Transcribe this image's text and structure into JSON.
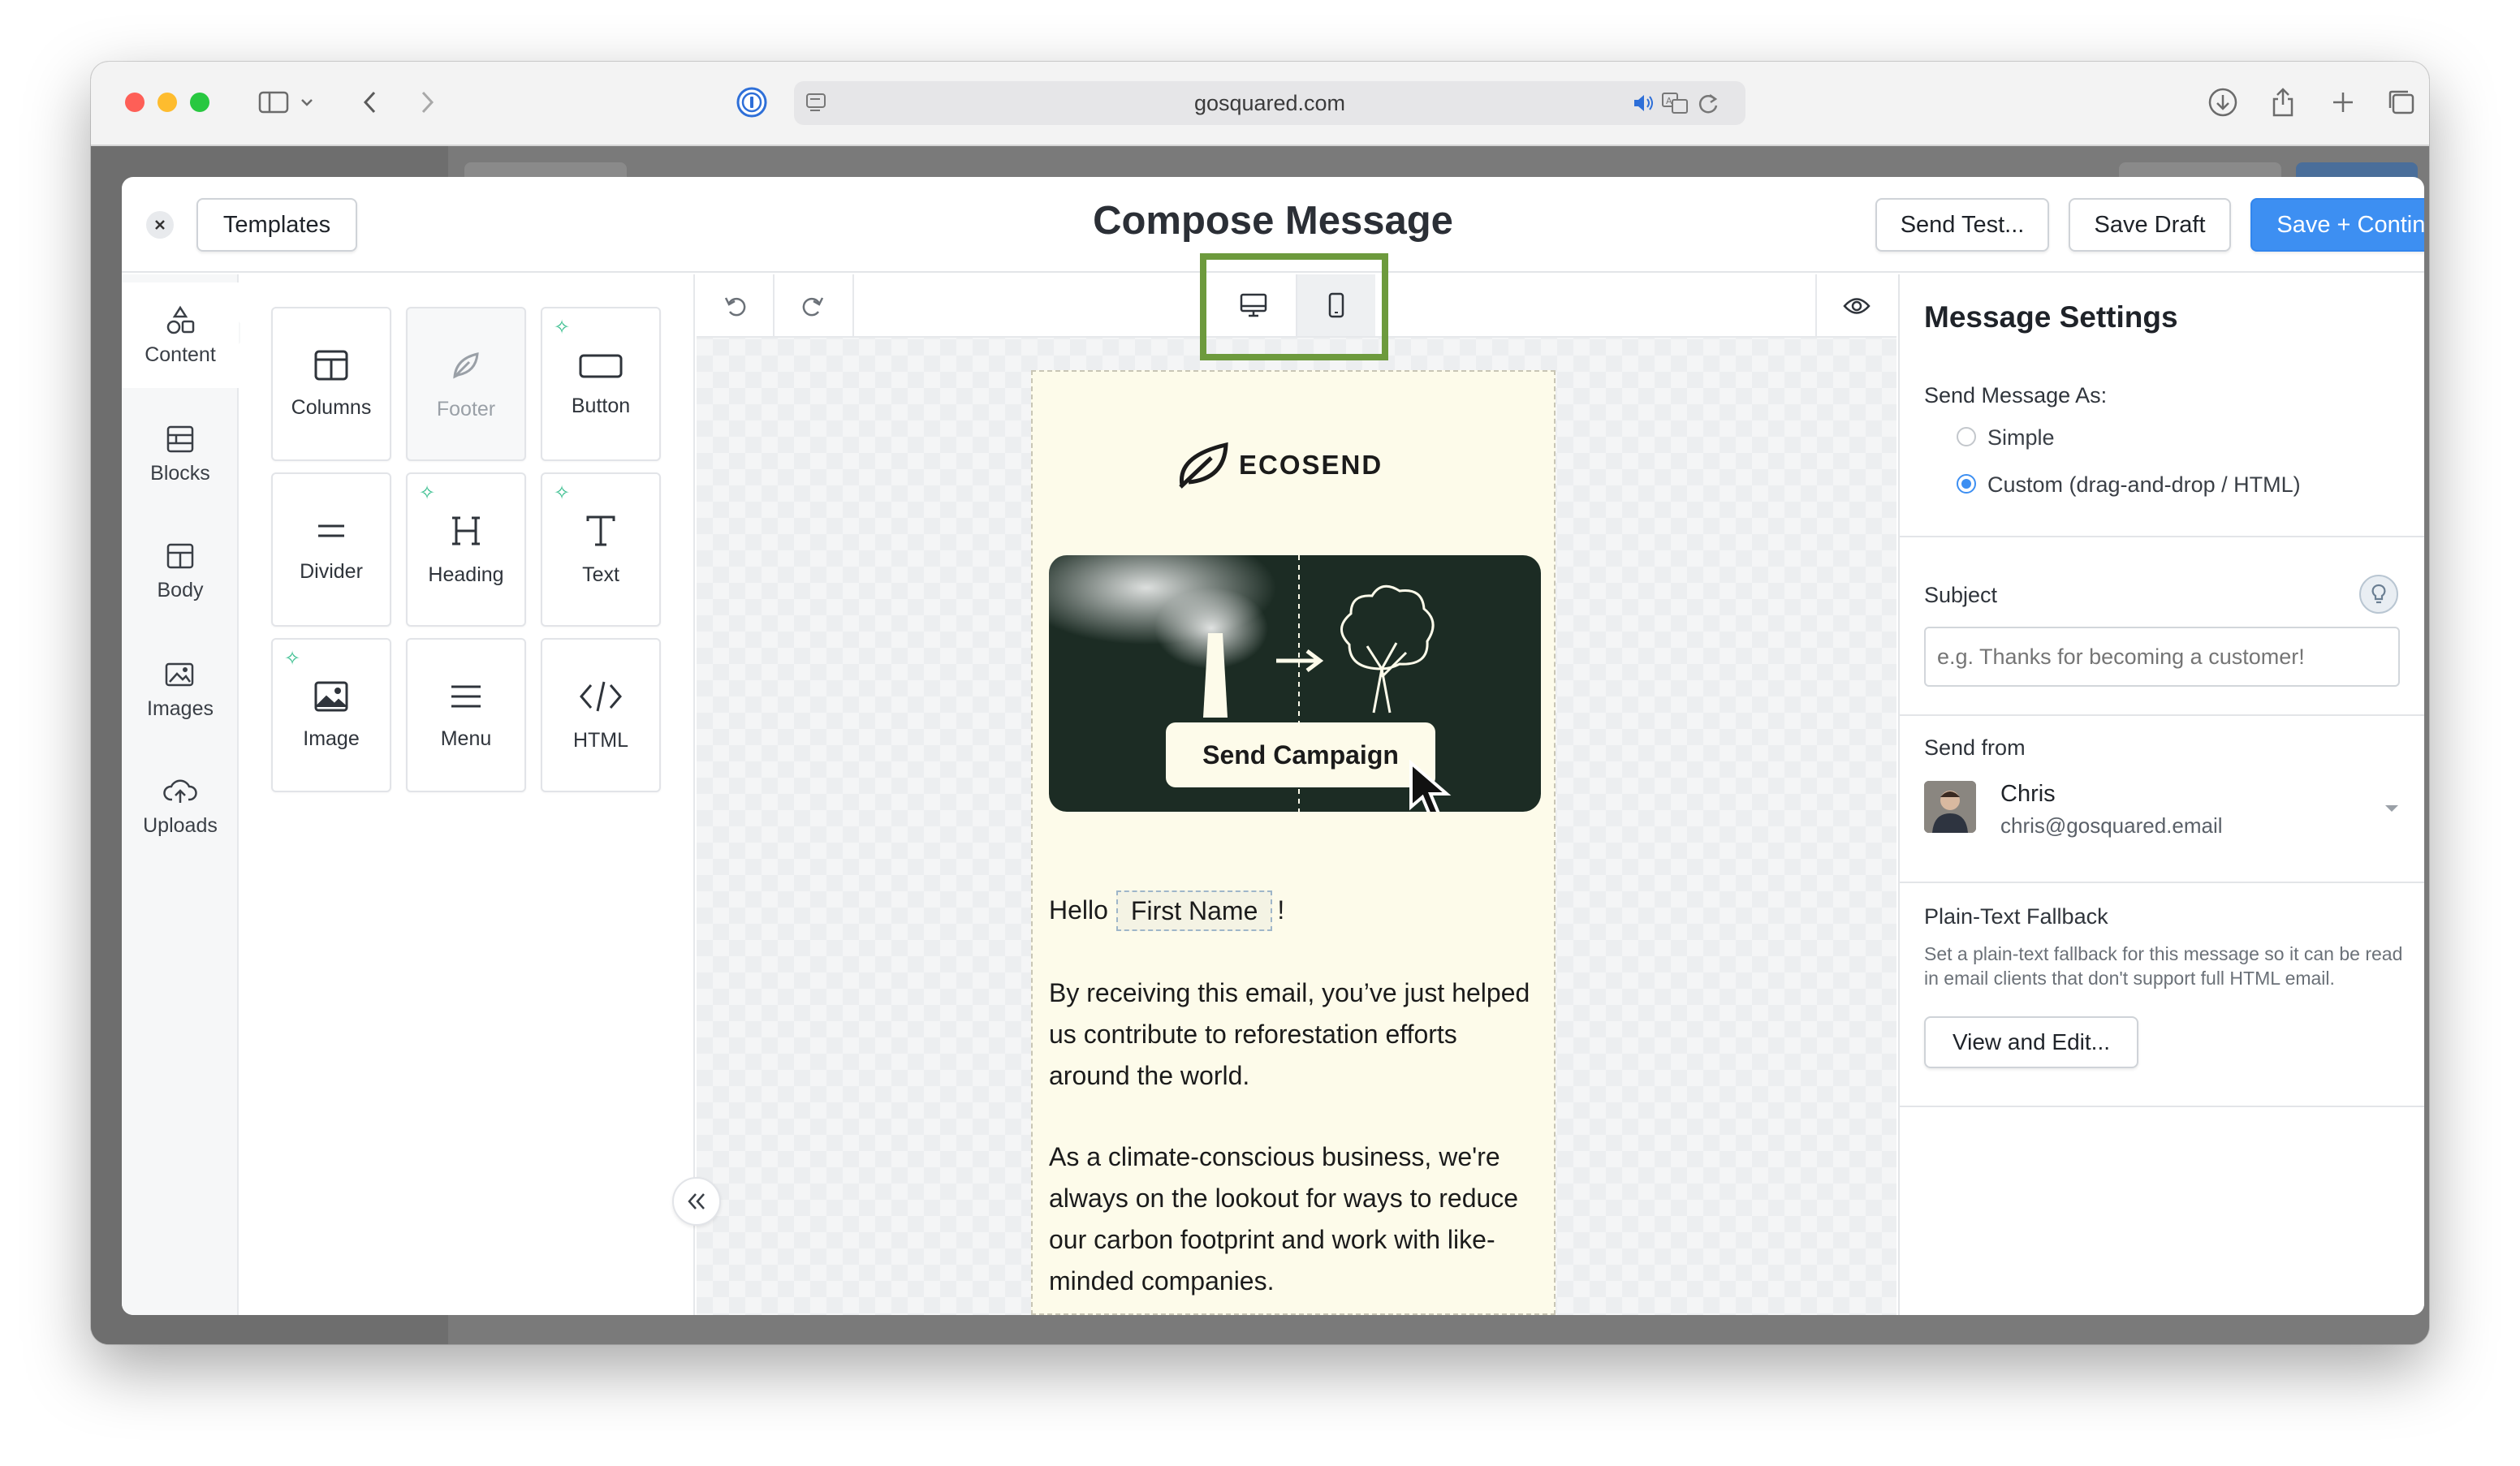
{
  "browser": {
    "url": "gosquared.com"
  },
  "modal": {
    "title": "Compose Message",
    "templates_label": "Templates",
    "send_test_label": "Send Test...",
    "save_draft_label": "Save Draft",
    "save_continue_label": "Save + Continue"
  },
  "rail": {
    "items": [
      {
        "label": "Content",
        "icon": "shapes-icon"
      },
      {
        "label": "Blocks",
        "icon": "blocks-icon"
      },
      {
        "label": "Body",
        "icon": "layout-icon"
      },
      {
        "label": "Images",
        "icon": "images-icon"
      },
      {
        "label": "Uploads",
        "icon": "cloud-upload-icon"
      }
    ]
  },
  "tools": {
    "tiles": [
      {
        "label": "Columns",
        "icon": "columns-icon"
      },
      {
        "label": "Footer",
        "icon": "feather-icon"
      },
      {
        "label": "Button",
        "icon": "button-icon"
      },
      {
        "label": "Divider",
        "icon": "divider-icon"
      },
      {
        "label": "Heading",
        "icon": "heading-icon"
      },
      {
        "label": "Text",
        "icon": "text-icon"
      },
      {
        "label": "Image",
        "icon": "image-icon"
      },
      {
        "label": "Menu",
        "icon": "menu-icon"
      },
      {
        "label": "HTML",
        "icon": "code-icon"
      }
    ]
  },
  "email": {
    "brand": "ECOSEND",
    "hero_button": "Send Campaign",
    "greeting_prefix": "Hello",
    "merge_tag": "First Name",
    "greeting_suffix": "!",
    "para1": "By receiving this email, you’ve just helped us contribute to reforestation efforts around the world.",
    "para2": "As a climate-conscious business, we're always on the lookout for ways to reduce our carbon footprint and work with like-minded companies."
  },
  "settings": {
    "title": "Message Settings",
    "send_as_label": "Send Message As:",
    "option_simple": "Simple",
    "option_custom": "Custom (drag-and-drop / HTML)",
    "subject_label": "Subject",
    "subject_placeholder": "e.g. Thanks for becoming a customer!",
    "send_from_label": "Send from",
    "sender_name": "Chris",
    "sender_email": "chris@gosquared.email",
    "fallback_title": "Plain-Text Fallback",
    "fallback_desc": "Set a plain-text fallback for this message so it can be read in email clients that don't support full HTML email.",
    "view_edit_label": "View and Edit..."
  },
  "colors": {
    "accent": "#3d8ff2",
    "highlight": "#6d9a3d",
    "hero_bg": "#1c2c24",
    "email_bg": "#fdfbea"
  }
}
